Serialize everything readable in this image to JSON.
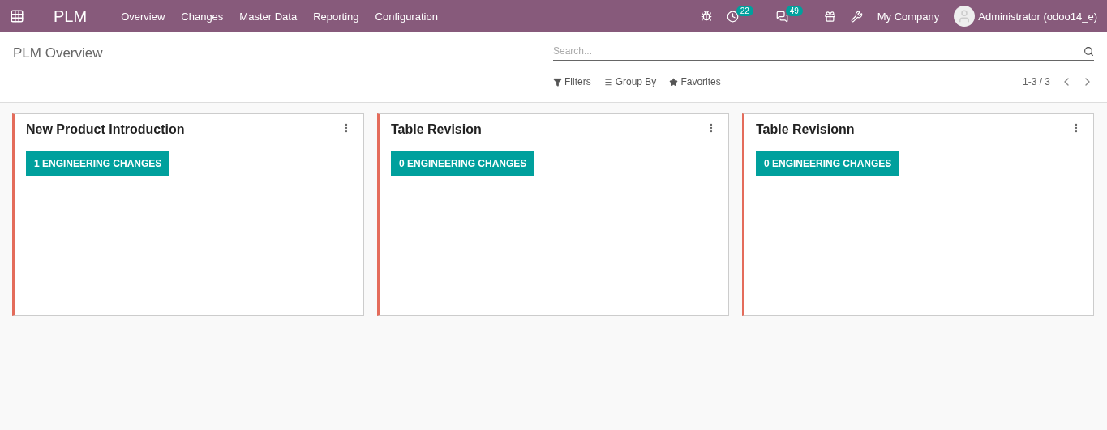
{
  "navbar": {
    "app_name": "PLM",
    "menu": [
      "Overview",
      "Changes",
      "Master Data",
      "Reporting",
      "Configuration"
    ],
    "activity_count": "22",
    "message_count": "49",
    "company": "My Company",
    "user": "Administrator (odoo14_e)"
  },
  "control_panel": {
    "title": "PLM Overview",
    "search": {
      "placeholder": "Search..."
    },
    "filters": [
      "Filters",
      "Group By",
      "Favorites"
    ],
    "pager": "1-3 / 3"
  },
  "cards": [
    {
      "title": "New Product Introduction",
      "button": "1 ENGINEERING CHANGES"
    },
    {
      "title": "Table Revision",
      "button": "0 ENGINEERING CHANGES"
    },
    {
      "title": "Table Revisionn",
      "button": "0 ENGINEERING CHANGES"
    }
  ]
}
